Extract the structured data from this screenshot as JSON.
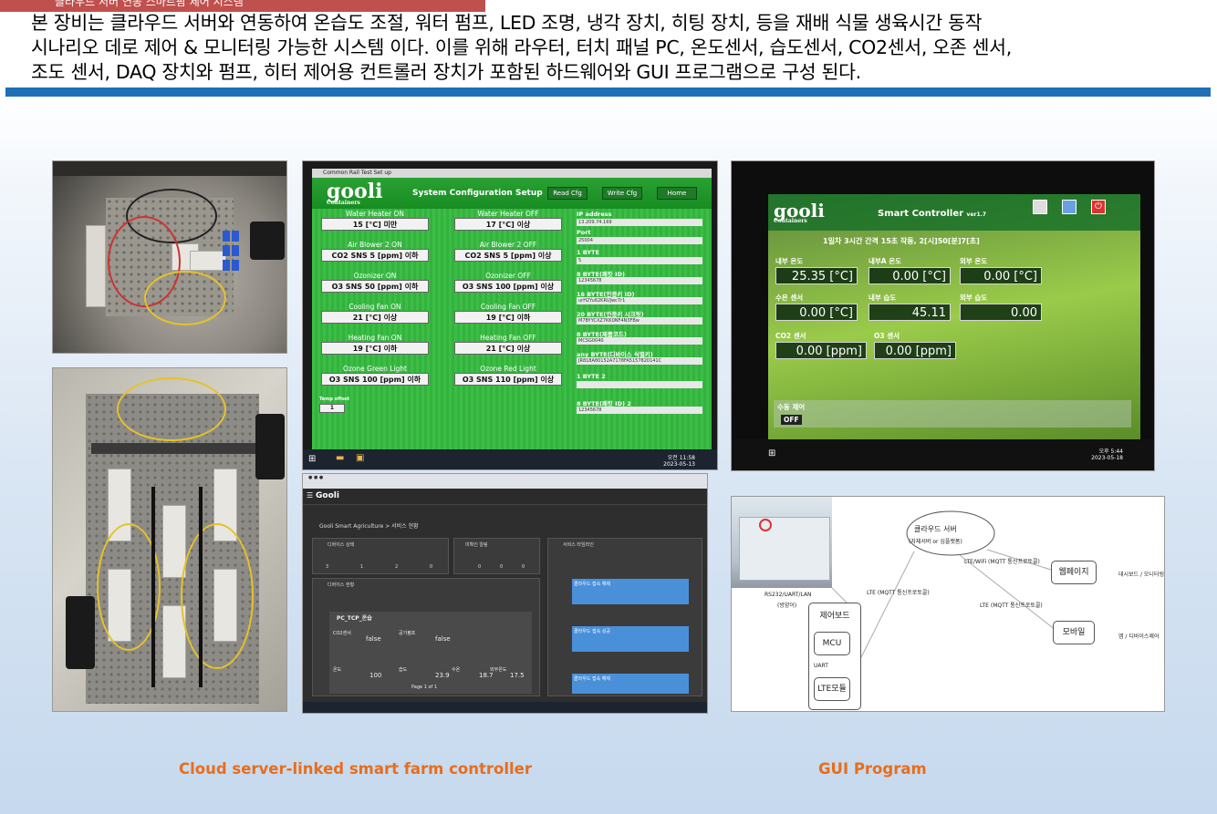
{
  "header": {
    "title_tab": "클라우드 서버 연동 스마트팜 제어 시스템",
    "intro_lines": [
      "본 장비는 클라우드 서버와 연동하여 온습도 조절, 워터 펌프, LED 조명, 냉각 장치, 히팅 장치, 등을  재배 식물 생육시간 동작",
      "시나리오 데로 제어 & 모니터링 가능한 시스템 이다. 이를 위해 라우터, 터치 패널 PC, 온도센서, 습도센서, CO2센서, 오존 센서,",
      "조도 센서, DAQ 장치와 펌프, 히터 제어용 컨트롤러 장치가 포함된 하드웨어와 GUI 프로그램으로 구성 된다."
    ]
  },
  "config_screen": {
    "window_title": "Common Rail Test Set up",
    "logo": "gooli",
    "logo_sub": "Containers",
    "title": "System Configuration Setup",
    "buttons": [
      "Read Cfg",
      "Write Cfg",
      "Home"
    ],
    "settings": [
      {
        "label": "Water Heater ON",
        "value": "15 [°C] 미만"
      },
      {
        "label": "Water Heater OFF",
        "value": "17 [°C] 이상"
      },
      {
        "label": "Air Blower 2 ON",
        "value": "CO2 SNS 5 [ppm] 이하"
      },
      {
        "label": "Air Blower 2 OFF",
        "value": "CO2 SNS 5 [ppm] 이상"
      },
      {
        "label": "Ozonizer ON",
        "value": "O3 SNS 50 [ppm] 이하"
      },
      {
        "label": "Ozonizer OFF",
        "value": "O3 SNS 100 [ppm] 이상"
      },
      {
        "label": "Cooling Fan ON",
        "value": "21 [°C] 이상"
      },
      {
        "label": "Cooling Fan OFF",
        "value": "19 [°C] 이하"
      },
      {
        "label": "Heating Fan ON",
        "value": "19 [°C] 이하"
      },
      {
        "label": "Heating Fan OFF",
        "value": "21 [°C] 이상"
      },
      {
        "label": "Ozone Green Light",
        "value": "O3 SNS 100 [ppm] 이하"
      },
      {
        "label": "Ozone Red Light",
        "value": "O3 SNS 110 [ppm] 이상"
      }
    ],
    "right_fields": [
      {
        "label": "IP address",
        "value": "13.209.74.169"
      },
      {
        "label": "Port",
        "value": "25004"
      },
      {
        "label": "1 BYTE",
        "value": "5"
      },
      {
        "label": "8 BYTE(패킷 ID)",
        "value": "12345678"
      },
      {
        "label": "16 BYTE(인증키 ID)",
        "value": "urH2Yu62KRUJwc7r1"
      },
      {
        "label": "20 BYTE(인증키 시크릿)",
        "value": "M7BYYCXZ7KK0NF4N3FBw"
      },
      {
        "label": "8 BYTE(제품코드)",
        "value": "MCSG0040"
      },
      {
        "label": "any BYTE(디바이스 식별키)",
        "value": "JR818A80152A7178FA5157820141C"
      },
      {
        "label": "1 BYTE 2",
        "value": ""
      },
      {
        "label": "8 BYTE(패킷 ID) 2",
        "value": "12345678"
      }
    ],
    "temp_offset_label": "Temp offset",
    "temp_offset_value": "1",
    "clock_time": "오전 11:58",
    "clock_date": "2023-05-13"
  },
  "controller_screen": {
    "logo": "gooli",
    "logo_sub": "Containers",
    "title": "Smart Controller",
    "version": "ver1.7",
    "schedule": "1일차 3시간 간격 15초 작동, 2[시]50[분]7[초]",
    "readings": [
      {
        "label": "내부 온도",
        "value": "25.35 [°C]"
      },
      {
        "label": "내부A 온도",
        "value": "0.00 [°C]"
      },
      {
        "label": "외부 온도",
        "value": "0.00 [°C]"
      },
      {
        "label": "수온 센서",
        "value": "0.00 [°C]"
      },
      {
        "label": "내부 습도",
        "value": "45.11"
      },
      {
        "label": "외부 습도",
        "value": "0.00"
      },
      {
        "label": "CO2 센서",
        "value": "0.00 [ppm]"
      },
      {
        "label": "O3 센서",
        "value": "0.00 [ppm]"
      }
    ],
    "control_label": "수동 제어",
    "control_state": "OFF",
    "clock_time": "오후 5:44",
    "clock_date": "2023-05-18"
  },
  "dashboard": {
    "brand": "Gooli",
    "breadcrumb": "Gooli Smart Agriculture > 서비스 현황",
    "panels": [
      "디바이스 상태",
      "미확인 알림",
      "서비스 타임라인",
      "디바이스 현황"
    ],
    "device_counts": [
      "3",
      "1",
      "2",
      "0"
    ],
    "alert_counts": [
      "0",
      "0",
      "0",
      "0"
    ],
    "device_name": "PC_TCP_온습",
    "table_rows": [
      {
        "label": "CO2센서",
        "value": "false"
      },
      {
        "label": "공기펌프",
        "value": "false"
      },
      {
        "label": "온도",
        "value": "100"
      },
      {
        "label": "습도",
        "value": "23.9"
      },
      {
        "label": "수온",
        "value": "18.7"
      },
      {
        "label": "외부온도",
        "value": "17.5"
      }
    ],
    "timeline": [
      "클라우드 접속 해제",
      "클라우드 접속 성공",
      "클라우드 접속 해제"
    ],
    "page": "Page 1 of 1"
  },
  "diagram": {
    "cloud": "클라우드 서버",
    "cloud_sub": "(자체서버 or 심플랫폼)",
    "web": "웹페이지",
    "web_desc": "대시보드 / 모니터링",
    "mobile": "모바일",
    "mobile_desc": "앱 / 디바이스제어",
    "control_board": "제어보드",
    "mcu": "MCU",
    "uart": "UART",
    "lte_module": "LTE모듈",
    "link_wifi": "LTE/WiFi (MQTT 통신프로토콜)",
    "link_lte1": "LTE (MQTT 통신프로토콜)",
    "link_lte2": "LTE (MQTT 통신프로토콜)",
    "serial": "RS232/UART/LAN",
    "serial_sub": "(방양어)"
  },
  "captions": {
    "left": "Cloud server-linked smart farm controller",
    "right": "GUI Program"
  }
}
